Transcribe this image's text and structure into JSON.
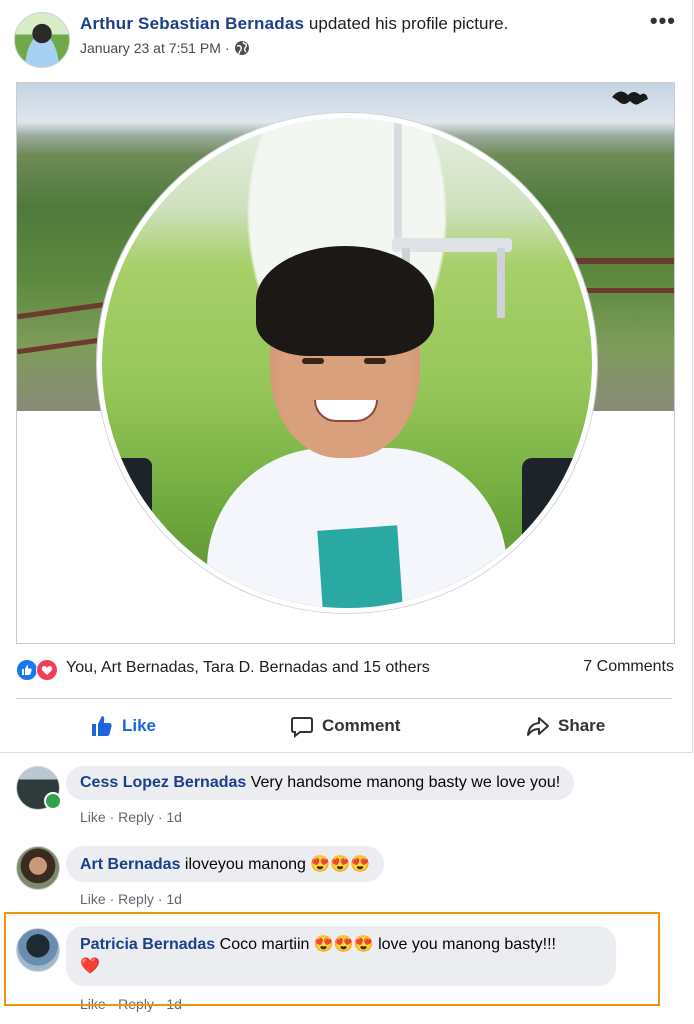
{
  "post": {
    "author": "Arthur Sebastian Bernadas",
    "action_text": " updated his profile picture.",
    "timestamp": "January 23 at 7:51 PM",
    "separator": " · ",
    "privacy_icon": "globe-icon",
    "more_label": "•••"
  },
  "reactions": {
    "names": "You, Art Bernadas, Tara D. Bernadas and 15 others",
    "comment_count": "7 Comments",
    "icons": [
      "like-icon",
      "love-icon"
    ]
  },
  "actions": {
    "like": "Like",
    "comment": "Comment",
    "share": "Share"
  },
  "comments": [
    {
      "name": "Cess Lopez Bernadas",
      "text": " Very handsome manong basty we love you!",
      "like": "Like",
      "reply": "Reply",
      "age": "1d"
    },
    {
      "name": "Art Bernadas",
      "text": " iloveyou manong ",
      "emojis": "😍😍😍",
      "like": "Like",
      "reply": "Reply",
      "age": "1d"
    },
    {
      "name": "Patricia Bernadas",
      "text": " Coco martiin ",
      "emojis": "😍😍😍",
      "text2": " love you manong basty!!!",
      "heart": "❤️",
      "like": "Like",
      "reply": "Reply",
      "age": "1d"
    }
  ],
  "colors": {
    "link": "#1c3f8a",
    "like_blue": "#1b65e0",
    "highlight": "#f0950f",
    "online": "#31a24c"
  }
}
